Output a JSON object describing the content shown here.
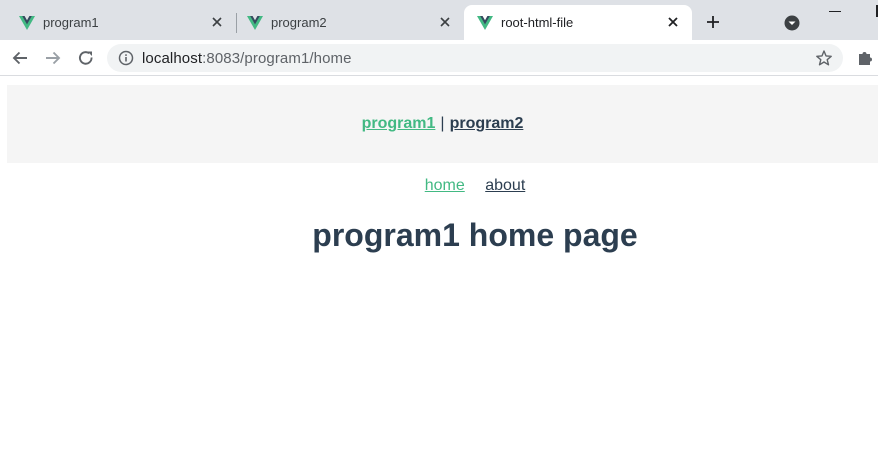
{
  "browser": {
    "tabs": [
      {
        "title": "program1",
        "active": false
      },
      {
        "title": "program2",
        "active": false
      },
      {
        "title": "root-html-file",
        "active": true
      }
    ],
    "address": {
      "host": "localhost",
      "rest": ":8083/program1/home"
    }
  },
  "app": {
    "programs": [
      {
        "label": "program1",
        "active": true
      },
      {
        "label": "program2",
        "active": false
      }
    ],
    "separator": "|",
    "routes": [
      {
        "label": "home",
        "active": true
      },
      {
        "label": "about",
        "active": false
      }
    ],
    "heading": "program1 home page"
  },
  "colors": {
    "vue_green": "#42b983",
    "vue_dark": "#35495e",
    "text": "#2c3e50",
    "tabstrip": "#dee1e6",
    "nav_bg": "#f5f5f5"
  },
  "icons": {
    "tab_favicon": "vue-logo-icon",
    "tab_close": "close-icon",
    "new_tab": "plus-icon",
    "tab_search": "tab-search-icon",
    "back": "back-arrow-icon",
    "forward": "forward-arrow-icon",
    "reload": "reload-icon",
    "site_info": "info-icon",
    "bookmark": "star-icon",
    "extensions": "puzzle-icon"
  }
}
